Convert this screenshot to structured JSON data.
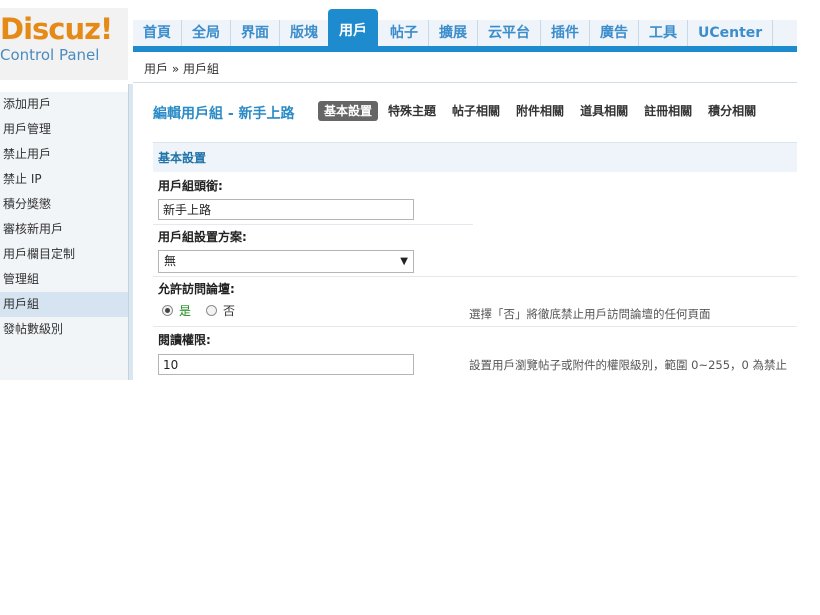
{
  "logo": {
    "brand": "Discuz!",
    "subtitle": "Control Panel"
  },
  "nav": {
    "items": [
      {
        "label": "首頁"
      },
      {
        "label": "全局"
      },
      {
        "label": "界面"
      },
      {
        "label": "版塊"
      },
      {
        "label": "用戶",
        "active": true
      },
      {
        "label": "帖子"
      },
      {
        "label": "擴展"
      },
      {
        "label": "云平台"
      },
      {
        "label": "插件"
      },
      {
        "label": "廣告"
      },
      {
        "label": "工具"
      },
      {
        "label": "UCenter"
      }
    ]
  },
  "breadcrumb": "用戶 » 用戶組",
  "sidebar": {
    "items": [
      {
        "label": "添加用戶"
      },
      {
        "label": "用戶管理"
      },
      {
        "label": "禁止用戶"
      },
      {
        "label": "禁止 IP"
      },
      {
        "label": "積分獎懲"
      },
      {
        "label": "審核新用戶"
      },
      {
        "label": "用戶欄目定制"
      },
      {
        "label": "管理組"
      },
      {
        "label": "用戶組",
        "active": true
      },
      {
        "label": "發帖數級別"
      }
    ]
  },
  "page": {
    "title": "編輯用戶組 - 新手上路",
    "tabs": [
      {
        "label": "基本設置",
        "active": true
      },
      {
        "label": "特殊主題"
      },
      {
        "label": "帖子相關"
      },
      {
        "label": "附件相關"
      },
      {
        "label": "道具相關"
      },
      {
        "label": "註冊相關"
      },
      {
        "label": "積分相關"
      }
    ],
    "section_title": "基本設置"
  },
  "form": {
    "group_title": {
      "label": "用戶組頭銜:",
      "value": "新手上路"
    },
    "scheme": {
      "label": "用戶組設置方案:",
      "selected": "無"
    },
    "allow_visit": {
      "label": "允許訪問論壇:",
      "yes": "是",
      "no": "否",
      "selected": "yes",
      "hint": "選擇「否」將徹底禁止用戶訪問論壇的任何頁面"
    },
    "read_access": {
      "label": "閱讀權限:",
      "value": "10",
      "hint": "設置用戶瀏覽帖子或附件的權限級別，範圍 0~255，0 為禁止"
    }
  }
}
